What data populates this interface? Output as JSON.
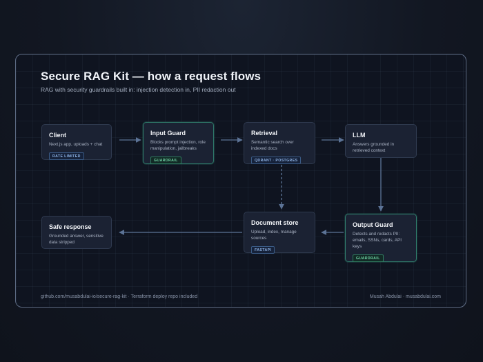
{
  "title": "Secure RAG Kit — how a request flows",
  "subtitle": "RAG with security guardrails built in: injection detection in, PII redaction out",
  "nodes": {
    "client": {
      "title": "Client",
      "desc": "Next.js app, uploads + chat",
      "badge": "RATE LIMITED"
    },
    "input_guard": {
      "title": "Input Guard",
      "desc": "Blocks prompt injection, role manipulation, jailbreaks",
      "badge": "GUARDRAIL"
    },
    "retrieval": {
      "title": "Retrieval",
      "desc": "Semantic search over indexed docs",
      "badge": "QDRANT · POSTGRES"
    },
    "llm": {
      "title": "LLM",
      "desc": "Answers grounded in retrieved context"
    },
    "output_guard": {
      "title": "Output Guard",
      "desc": "Detects and redacts PII: emails, SSNs, cards, API keys",
      "badge": "GUARDRAIL"
    },
    "document_store": {
      "title": "Document store",
      "desc": "Upload, index, manage sources",
      "badge": "FASTAPI"
    },
    "safe_response": {
      "title": "Safe response",
      "desc": "Grounded answer, sensitive data stripped"
    }
  },
  "footer": {
    "left": "github.com/musabdulai-io/secure-rag-kit · Terraform deploy repo included",
    "right": "Musah Abdulai · musabdulai.com"
  },
  "colors": {
    "guardrail_border": "#2f7a6a",
    "guardrail_badge": "#6fd3a4",
    "tech_badge": "#8fb4e6",
    "arrow": "#5c7396"
  }
}
